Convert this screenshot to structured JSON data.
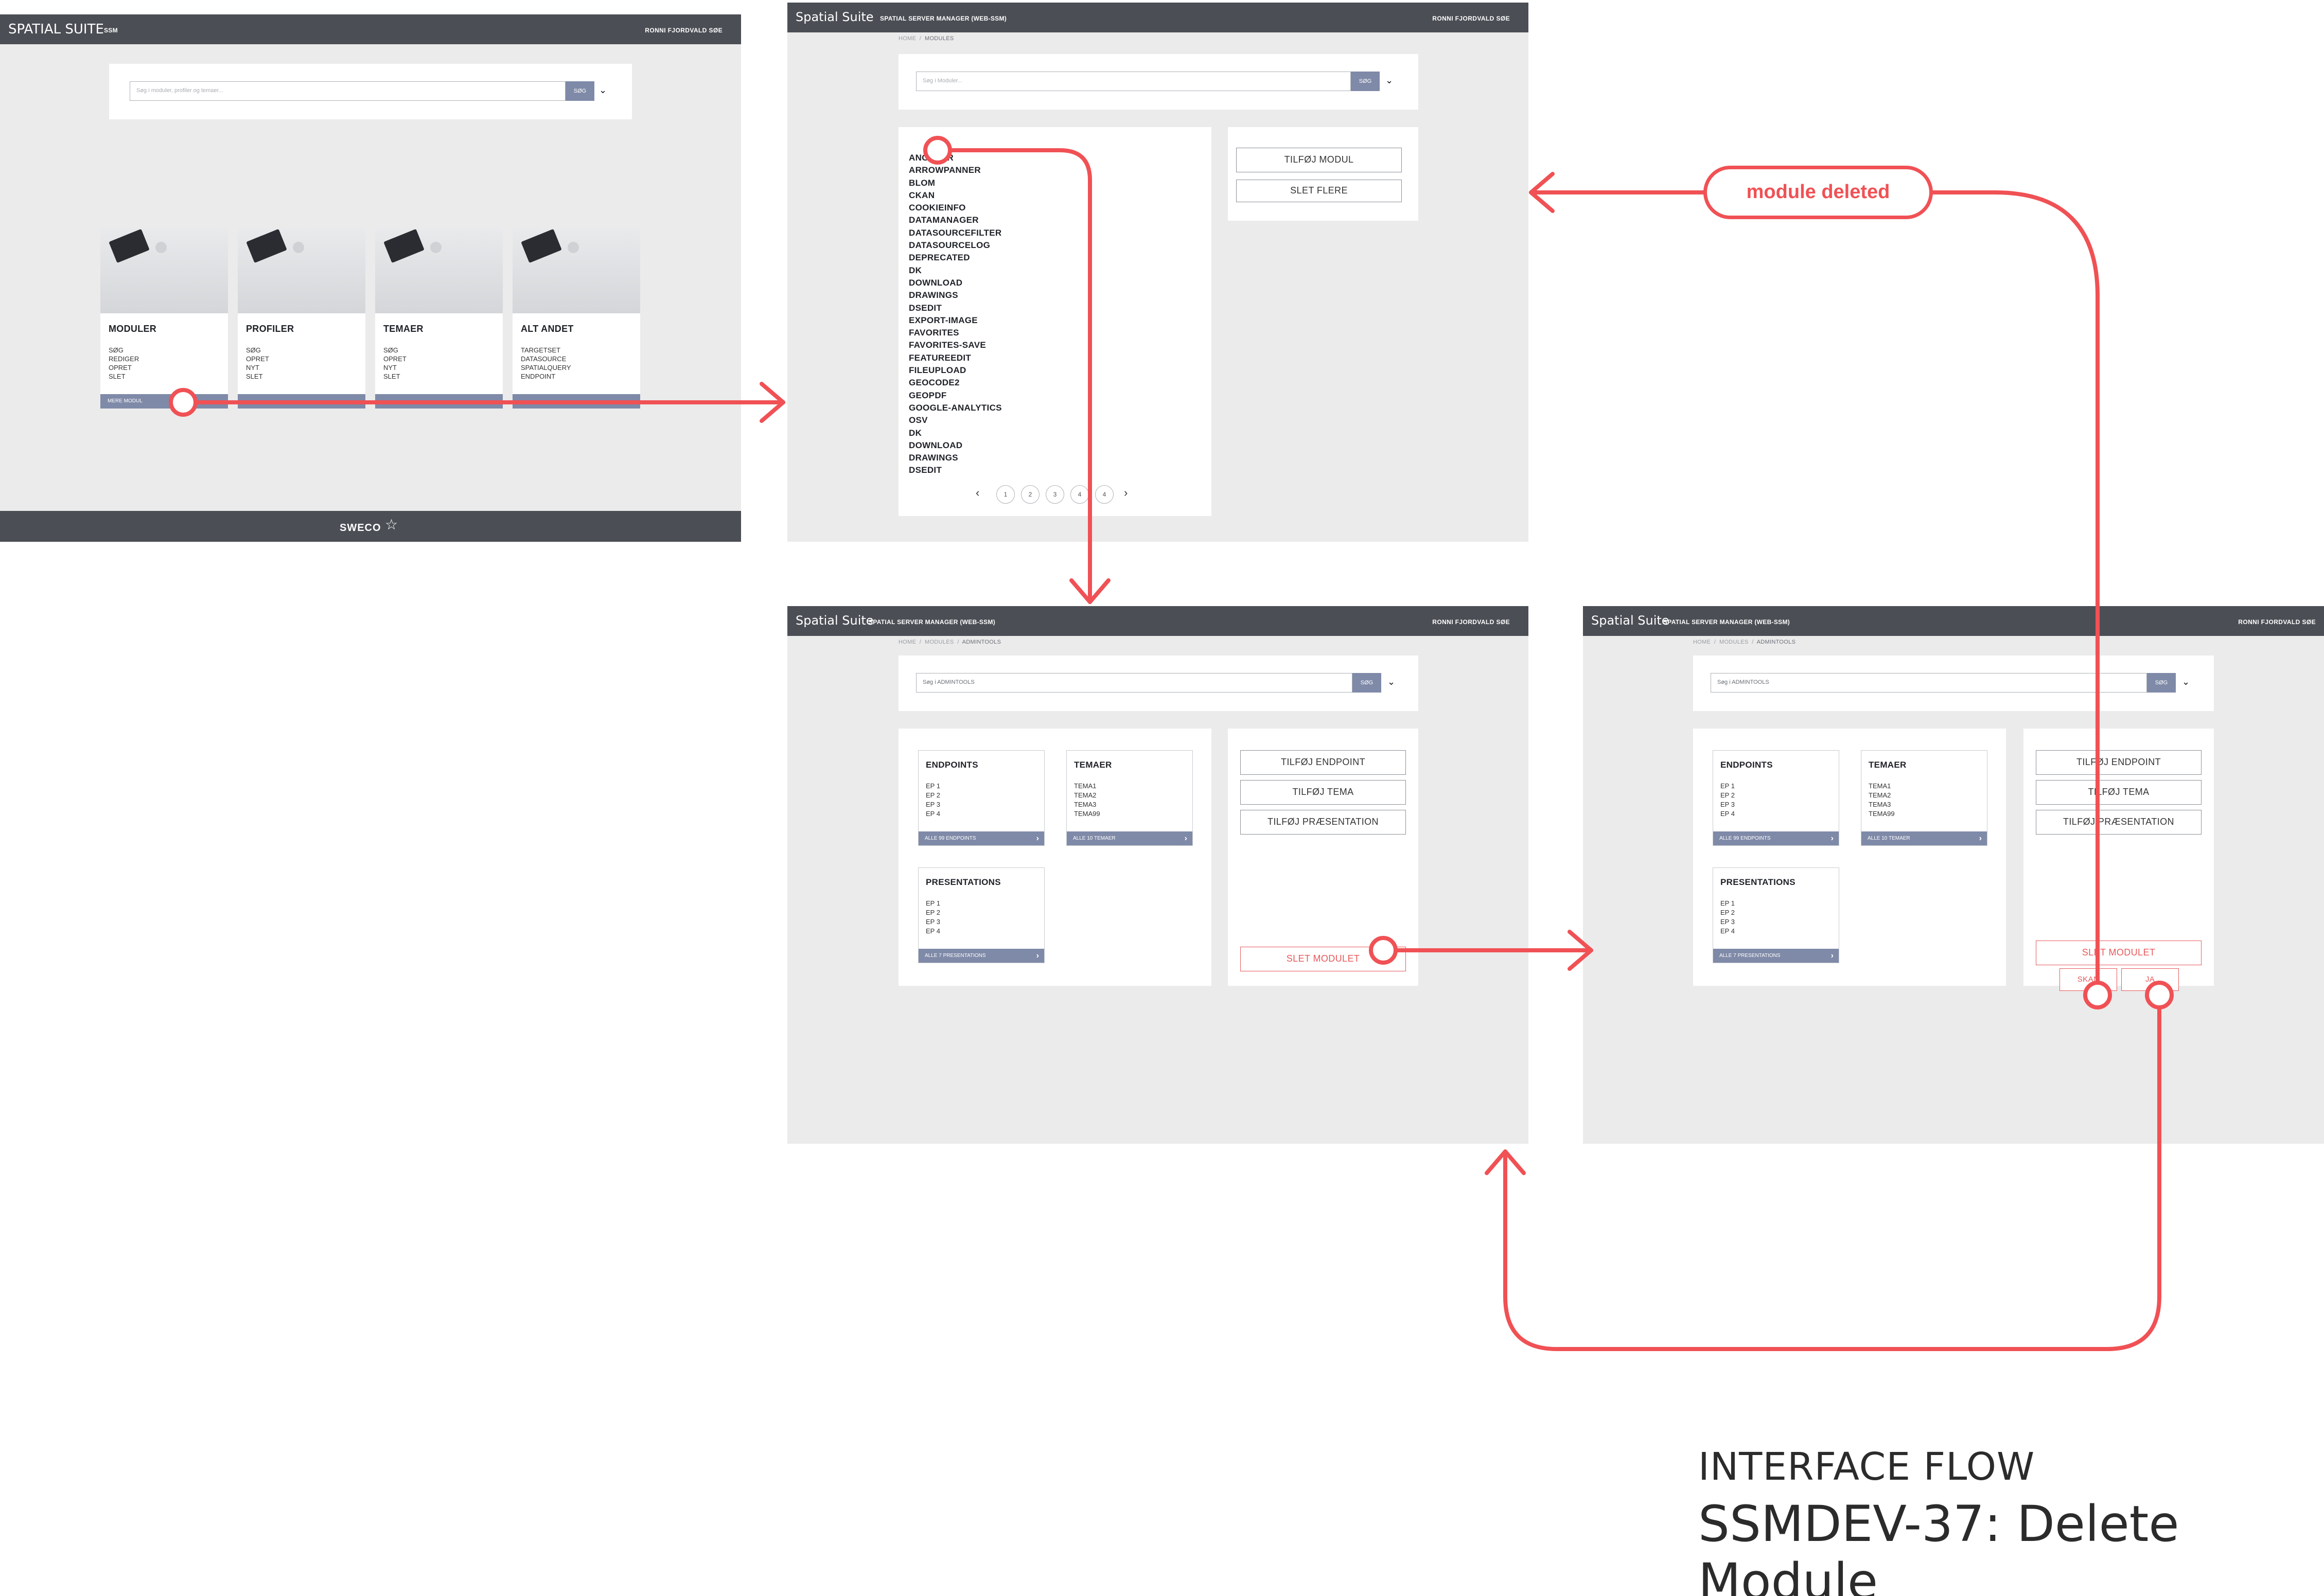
{
  "screen1": {
    "brand": "SPATIAL SUITE",
    "brand_sub": "SSM",
    "user": "RONNI FJORDVALD SØE",
    "search_placeholder": "Søg i moduler, profiler og temaer...",
    "search_button": "SØG",
    "cards": [
      {
        "title": "MODULER",
        "items": [
          "SØG",
          "REDIGER",
          "OPRET",
          "SLET"
        ],
        "bar": "MERE MODUL"
      },
      {
        "title": "PROFILER",
        "items": [
          "SØG",
          "OPRET",
          "NYT",
          "SLET"
        ],
        "bar": ""
      },
      {
        "title": "TEMAER",
        "items": [
          "SØG",
          "OPRET",
          "NYT",
          "SLET"
        ],
        "bar": ""
      },
      {
        "title": "ALT ANDET",
        "items": [
          "TARGETSET",
          "DATASOURCE",
          "SPATIALQUERY",
          "ENDPOINT"
        ],
        "bar": ""
      }
    ],
    "footer_logo": "SWECO"
  },
  "screen2": {
    "brand": "Spatial Suite",
    "subtitle": "SPATIAL SERVER MANAGER (WEB-SSM)",
    "user": "RONNI FJORDVALD SØE",
    "crumb": [
      "HOME",
      "MODULES"
    ],
    "search_placeholder": "Søg i Moduler...",
    "search_button": "SØG",
    "modules": [
      "ANGULAR",
      "ARROWPANNER",
      "BLOM",
      "CKAN",
      "COOKIEINFO",
      "DATAMANAGER",
      "DATASOURCEFILTER",
      "DATASOURCELOG",
      "DEPRECATED",
      "DK",
      "DOWNLOAD",
      "DRAWINGS",
      "DSEDIT",
      "EXPORT-IMAGE",
      "FAVORITES",
      "FAVORITES-SAVE",
      "FEATUREEDIT",
      "FILEUPLOAD",
      "GEOCODE2",
      "GEOPDF",
      "GOOGLE-ANALYTICS",
      "OSV",
      "DK",
      "DOWNLOAD",
      "DRAWINGS",
      "DSEDIT"
    ],
    "pages": [
      "1",
      "2",
      "3",
      "4",
      "4"
    ],
    "add_module": "TILFØJ MODUL",
    "delete_more": "SLET FLERE"
  },
  "screen3": {
    "brand": "Spatial Suite",
    "subtitle": "SPATIAL SERVER MANAGER (WEB-SSM)",
    "user": "RONNI FJORDVALD SØE",
    "crumb": [
      "HOME",
      "MODULES",
      "ADMINTOOLS"
    ],
    "search_value": "Søg i ADMINTOOLS",
    "search_button": "SØG",
    "endpoints": {
      "title": "ENDPOINTS",
      "items": [
        "EP 1",
        "EP 2",
        "EP 3",
        "EP 4"
      ],
      "bar": "ALLE 99 ENDPOINTS"
    },
    "temaer": {
      "title": "TEMAER",
      "items": [
        "TEMA1",
        "TEMA2",
        "TEMA3",
        "TEMA99"
      ],
      "bar": "ALLE 10 TEMAER"
    },
    "presentations": {
      "title": "PRESENTATIONS",
      "items": [
        "EP 1",
        "EP 2",
        "EP 3",
        "EP 4"
      ],
      "bar": "ALLE 7 PRESENTATIONS"
    },
    "add_endpoint": "TILFØJ ENDPOINT",
    "add_tema": "TILFØJ TEMA",
    "add_presentation": "TILFØJ PRÆSENTATION",
    "delete_module": "SLET MODULET"
  },
  "screen4": {
    "brand": "Spatial Suite",
    "subtitle": "SPATIAL SERVER MANAGER (WEB-SSM)",
    "user": "RONNI FJORDVALD SØE",
    "crumb": [
      "HOME",
      "MODULES",
      "ADMINTOOLS"
    ],
    "search_value": "Søg i ADMINTOOLS",
    "search_button": "SØG",
    "endpoints": {
      "title": "ENDPOINTS",
      "items": [
        "EP 1",
        "EP 2",
        "EP 3",
        "EP 4"
      ],
      "bar": "ALLE 99 ENDPOINTS"
    },
    "temaer": {
      "title": "TEMAER",
      "items": [
        "TEMA1",
        "TEMA2",
        "TEMA3",
        "TEMA99"
      ],
      "bar": "ALLE 10 TEMAER"
    },
    "presentations": {
      "title": "PRESENTATIONS",
      "items": [
        "EP 1",
        "EP 2",
        "EP 3",
        "EP 4"
      ],
      "bar": "ALLE 7 PRESENTATIONS"
    },
    "add_endpoint": "TILFØJ ENDPOINT",
    "add_tema": "TILFØJ TEMA",
    "add_presentation": "TILFØJ PRÆSENTATION",
    "delete_module": "SLET MODULET",
    "cancel": "SKAN",
    "confirm": "JA"
  },
  "flow_label": "module deleted",
  "title_line1": "INTERFACE FLOW",
  "title_line2": "SSMDEV-37: Delete Module",
  "colors": {
    "accent": "#f05155",
    "header": "#4b4e55",
    "bar": "#7f8aa8",
    "screen_bg": "#ebebeb"
  }
}
